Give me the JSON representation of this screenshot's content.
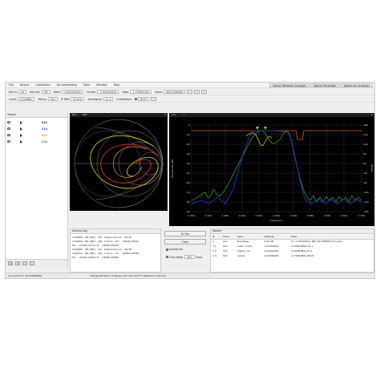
{
  "menu": [
    "File",
    "Device",
    "Calibration",
    "De-embedding",
    "Tools",
    "Window",
    "Help"
  ],
  "modes": [
    "Vector Network Analyzer",
    "Signal Generator",
    "Spectrum Analyzer"
  ],
  "toolbar1": {
    "ref_in_label": "Ref In:",
    "ref_in_value": "int",
    "ref_out_label": "Ref out:",
    "ref_out_value": "Off",
    "start_label": "Start:",
    "start_value": "1.30000GHz",
    "center_label": "Center:",
    "center_value": "1.50000GHz",
    "stop_label": "Stop:",
    "stop_value": "1.70000GHz",
    "span_label": "Span:",
    "span_value": "400.000MHz"
  },
  "toolbar2": {
    "level_label": "Level:",
    "level_value": "0.00dBm",
    "points_label": "Points:",
    "points_value": "501",
    "ifbw_label": "IF BW:",
    "ifbw_value": "10 kHz",
    "averaging_label": "Averaging:",
    "averaging_value": "1/ 1",
    "calibration_label": "Calibration:",
    "calibration_value": "SOLT"
  },
  "traces": {
    "title": "Traces",
    "items": [
      {
        "name": "S11",
        "color": "#1e1e1e"
      },
      {
        "name": "S12",
        "color": "#2a3ad6"
      },
      {
        "name": "S21",
        "color": "#c9b400"
      },
      {
        "name": "S22",
        "color": "#2a9a2a"
      }
    ]
  },
  "smith": {
    "title_left": "S11",
    "title_right": "S22"
  },
  "bode": {
    "title_left": "S21",
    "title_right": "S11",
    "y_left_label": "Magnitude (dB)",
    "y_right_label": "Phase",
    "x_label": "Frequency",
    "y_left_ticks": [
      "0",
      "-10",
      "-20",
      "-30",
      "-40",
      "-50",
      "-60",
      "-70",
      "-80",
      "-90"
    ],
    "y_right_ticks": [
      "180",
      "140",
      "100",
      "60",
      "20",
      "-20",
      "-60",
      "-100",
      "-140",
      "-180"
    ],
    "x_ticks": [
      "1.30G",
      "1.34G",
      "1.38G",
      "1.42G",
      "1.46G",
      "1.50G",
      "1.54G",
      "1.58G",
      "1.62G",
      "1.66G",
      "1.70G"
    ]
  },
  "device_log": {
    "title": "Device Log",
    "lines": [
      "1134684: HW:[MP]: PLL temperatures: 36/30",
      "1134684: HW:[MP]: ADC limits: P1: -20102/28341",
      "P2: -21168/21173 R: -26442/26446",
      "1134685: HW:[MP]: PLL temperatures: 36/30",
      "1144711: HW:[MP]: ADC limits: P1: -20283/20158",
      "P2: -21816/21824 R: -26686/26489"
    ]
  },
  "log_controls": {
    "to_file": "To File",
    "clear": "Clear",
    "autoscroll": "Autoscroll",
    "only_keep": "Only keep",
    "only_keep_value": "200",
    "lines": "lines"
  },
  "marker": {
    "title": "Marker",
    "columns": [
      "#",
      "Trace",
      "Type",
      "Settings",
      "Data"
    ],
    "rows": [
      {
        "num": "1",
        "trace": "S21",
        "type": "Bandpass",
        "settings": "3.00 dB",
        "data": "Fc: 1.52696GHz, BW: 26.338MHz, Ins.Loss..."
      },
      {
        "num": "1.1",
        "trace": "S21",
        "type": "lower cutoff",
        "settings": "1.51369GHz",
        "data": "-5.0960dB@172.1"
      },
      {
        "num": "1.2",
        "trace": "S21",
        "type": "higher cut...",
        "settings": "1.54003GHz",
        "data": "-4.6496dB@-15.1"
      },
      {
        "num": "1.3",
        "trace": "S21",
        "type": "center",
        "settings": "1.52696GHz",
        "data": "-0.7964dB@-180.8"
      }
    ]
  },
  "status": {
    "connected": "Connected to 207D9948550",
    "info": "HW Rev.B FW:0.1.0 Temps: 34°C/41°C/37°C Reference:Internal"
  }
}
